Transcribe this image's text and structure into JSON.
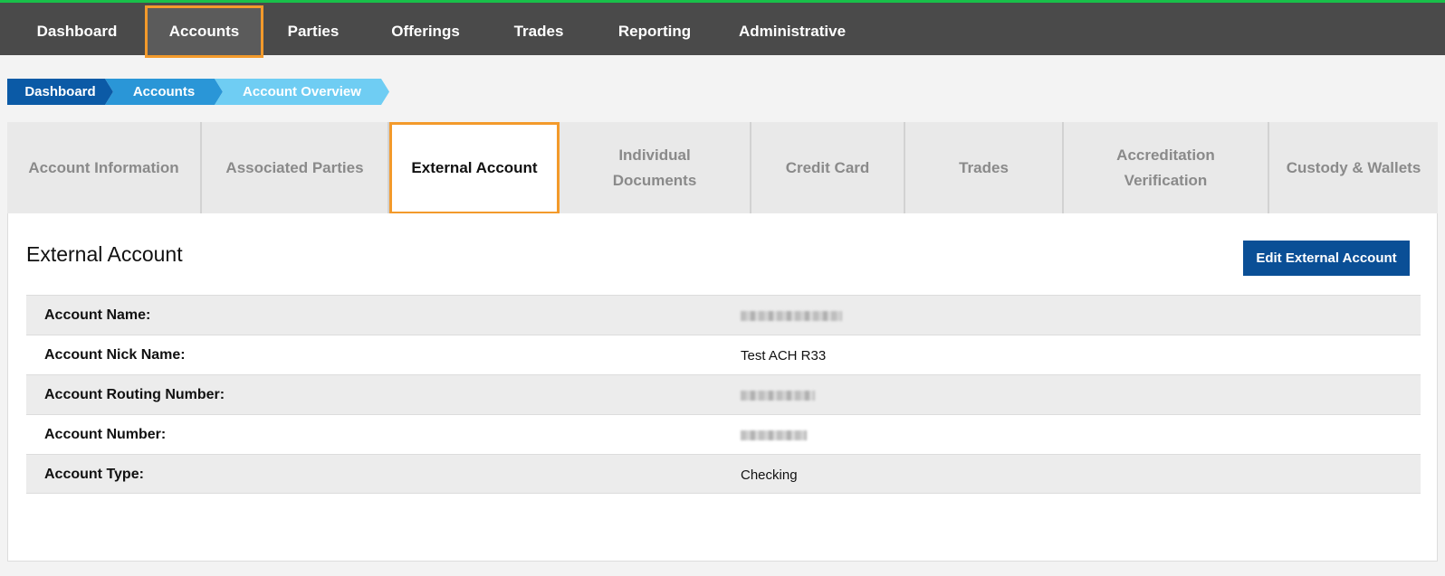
{
  "top_nav": {
    "items": [
      {
        "label": "Dashboard"
      },
      {
        "label": "Accounts",
        "active": true
      },
      {
        "label": "Parties"
      },
      {
        "label": "Offerings"
      },
      {
        "label": "Trades"
      },
      {
        "label": "Reporting"
      },
      {
        "label": "Administrative"
      }
    ]
  },
  "breadcrumb": [
    {
      "label": "Dashboard",
      "color": "#0b5aa6"
    },
    {
      "label": "Accounts",
      "color": "#2a96d7"
    },
    {
      "label": "Account Overview",
      "color": "#6fcdf3"
    }
  ],
  "tabs": [
    {
      "label": "Account Information"
    },
    {
      "label": "Associated Parties"
    },
    {
      "label": "External Account",
      "active": true
    },
    {
      "label": "Individual Documents"
    },
    {
      "label": "Credit Card"
    },
    {
      "label": "Trades"
    },
    {
      "label": "Accreditation Verification"
    },
    {
      "label": "Custody & Wallets"
    }
  ],
  "panel": {
    "title": "External Account",
    "edit_button": "Edit External Account",
    "rows": [
      {
        "label": "Account Name:",
        "value": null,
        "redacted": true
      },
      {
        "label": "Account Nick Name:",
        "value": "Test ACH R33"
      },
      {
        "label": "Account Routing Number:",
        "value": null,
        "redacted": true
      },
      {
        "label": "Account Number:",
        "value": null,
        "redacted": true
      },
      {
        "label": "Account Type:",
        "value": "Checking"
      }
    ]
  },
  "colors": {
    "accent_orange": "#f39a2b",
    "nav_bg": "#4a4a4a",
    "top_stripe": "#19c04a",
    "button_blue": "#0a4f96"
  }
}
